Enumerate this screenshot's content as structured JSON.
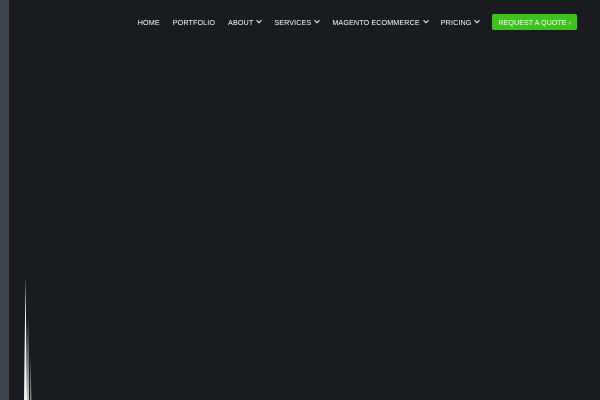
{
  "nav": {
    "items": [
      {
        "label": "HOME",
        "has_dropdown": false
      },
      {
        "label": "PORTFOLIO",
        "has_dropdown": false
      },
      {
        "label": "ABOUT",
        "has_dropdown": true
      },
      {
        "label": "SERVICES",
        "has_dropdown": true
      },
      {
        "label": "MAGENTO ECOMMERCE",
        "has_dropdown": true
      },
      {
        "label": "PRICING",
        "has_dropdown": true
      }
    ],
    "cta_label": "REQUEST A QUOTE ›"
  },
  "colors": {
    "page_background": "#3f434b",
    "hero_background": "#1a1b1f",
    "cta_background": "#3fc21f",
    "text": "#ffffff"
  }
}
